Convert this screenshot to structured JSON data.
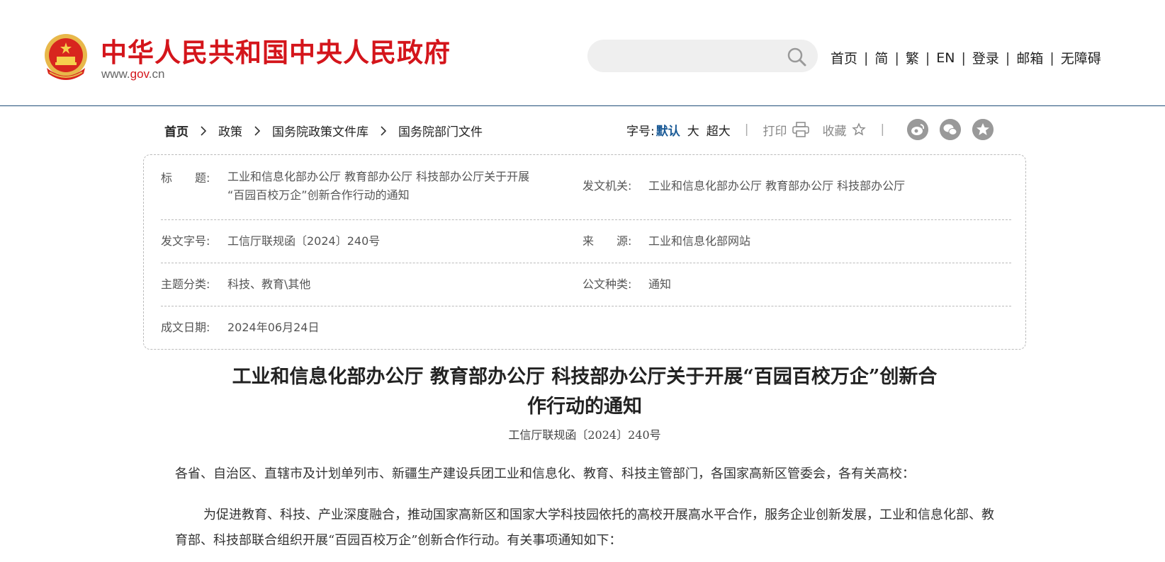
{
  "header": {
    "site_title": "中华人民共和国中央人民政府",
    "site_url_prefix": "www.",
    "site_url_gov": "gov",
    "site_url_suffix": ".cn",
    "search": {
      "value": "",
      "placeholder": ""
    },
    "nav": [
      "首页",
      "简",
      "繁",
      "EN",
      "登录",
      "邮箱",
      "无障碍"
    ],
    "nav_separator": "|"
  },
  "breadcrumb": [
    "首页",
    "政策",
    "国务院政策文件库",
    "国务院部门文件"
  ],
  "tools": {
    "font_size_label": "字号:",
    "font_default": "默认",
    "font_large": "大",
    "font_xlarge": "超大",
    "separator": "|",
    "print": "打印",
    "favorite": "收藏"
  },
  "info": {
    "title_label": "标　　题:",
    "title_value_line1": "工业和信息化部办公厅 教育部办公厅 科技部办公厅关于开展",
    "title_value_line2": "“百园百校万企”创新合作行动的通知",
    "issuer_label": "发文机关:",
    "issuer_value": "工业和信息化部办公厅 教育部办公厅 科技部办公厅",
    "docno_label": "发文字号:",
    "docno_value": "工信厅联规函〔2024〕240号",
    "source_label": "来　　源:",
    "source_value": "工业和信息化部网站",
    "topic_label": "主题分类:",
    "topic_value": "科技、教育\\其他",
    "type_label": "公文种类:",
    "type_value": "通知",
    "date_label": "成文日期:",
    "date_value": "2024年06月24日"
  },
  "article": {
    "title_line1": "工业和信息化部办公厅 教育部办公厅 科技部办公厅关于开展“百园百校万企”创新合",
    "title_line2": "作行动的通知",
    "doc_no": "工信厅联规函〔2024〕240号",
    "salutation": "各省、自治区、直辖市及计划单列市、新疆生产建设兵团工业和信息化、教育、科技主管部门，各国家高新区管委会，各有关高校：",
    "paragraph1": "为促进教育、科技、产业深度融合，推动国家高新区和国家大学科技园依托的高校开展高水平合作，服务企业创新发展，工业和信息化部、教育部、科技部联合组织开展“百园百校万企”创新合作行动。有关事项通知如下："
  },
  "colors": {
    "brand_red": "#d4151b",
    "link_blue": "#1a5a96",
    "header_rule": "#1f4e79",
    "social_gray": "#999999"
  },
  "icons": [
    "national-emblem-icon",
    "search-icon",
    "chevron-right-icon",
    "printer-icon",
    "star-icon",
    "weibo-icon",
    "wechat-icon",
    "share-star-icon"
  ]
}
